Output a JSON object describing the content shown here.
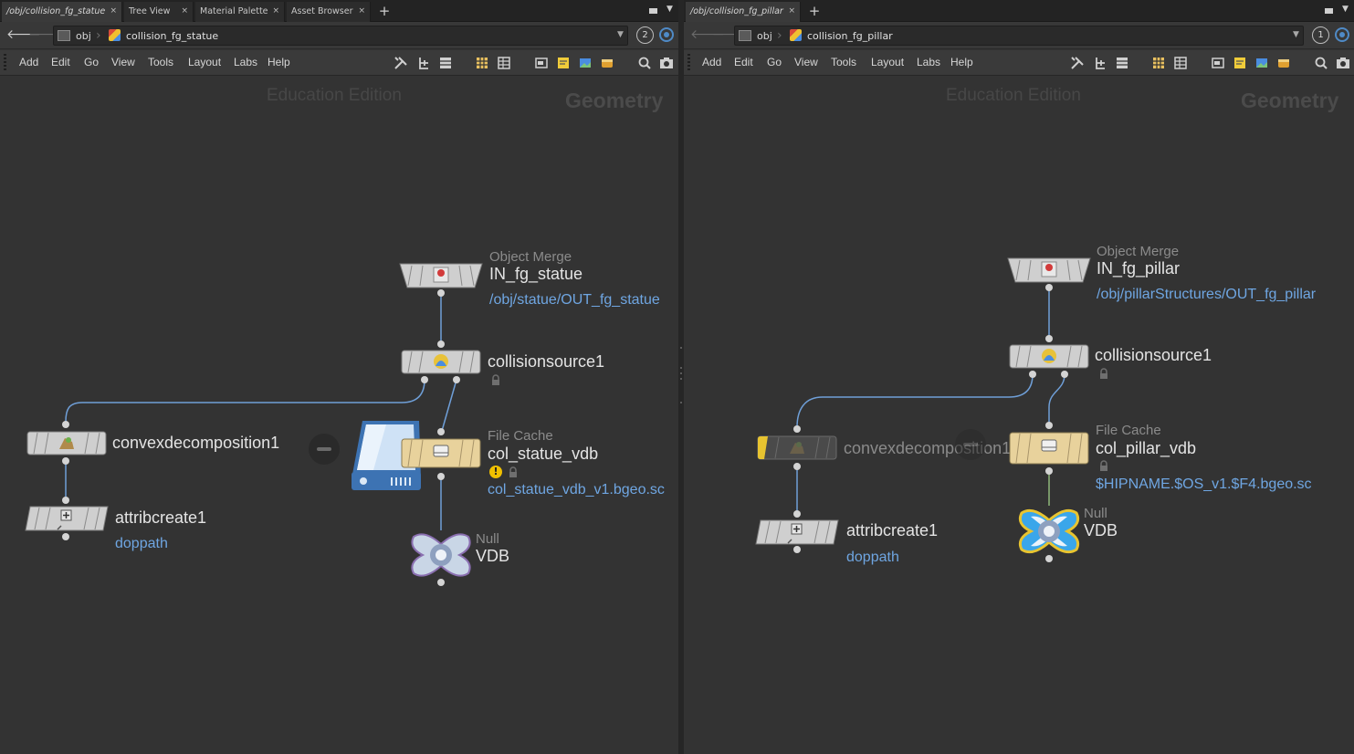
{
  "left": {
    "tabs": [
      {
        "label": "/obj/collision_fg_statue",
        "close": "×",
        "active": true
      },
      {
        "label": "Tree View",
        "close": "×"
      },
      {
        "label": "Material Palette",
        "close": "×"
      },
      {
        "label": "Asset Browser",
        "close": "×"
      }
    ],
    "add_tab": "+",
    "path": {
      "root": "obj",
      "network": "collision_fg_statue",
      "pin": "2"
    },
    "menu": [
      "Add",
      "Edit",
      "Go",
      "View",
      "Tools",
      "Layout",
      "Labs",
      "Help"
    ],
    "watermark": "Education Edition",
    "context": "Geometry",
    "nodes": {
      "object_merge": {
        "type": "Object Merge",
        "name": "IN_fg_statue",
        "path": "/obj/statue/OUT_fg_statue"
      },
      "collisionsource": {
        "name": "collisionsource1"
      },
      "convexdecomposition": {
        "name": "convexdecomposition1"
      },
      "attribcreate": {
        "name": "attribcreate1",
        "path": "doppath"
      },
      "file_cache": {
        "type": "File Cache",
        "name": "col_statue_vdb",
        "path": "col_statue_vdb_v1.bgeo.sc",
        "warning": "!"
      },
      "null": {
        "type": "Null",
        "name": "VDB"
      }
    }
  },
  "right": {
    "tabs": [
      {
        "label": "/obj/collision_fg_pillar",
        "close": "×",
        "active": true
      }
    ],
    "add_tab": "+",
    "path": {
      "root": "obj",
      "network": "collision_fg_pillar",
      "pin": "1"
    },
    "menu": [
      "Add",
      "Edit",
      "Go",
      "View",
      "Tools",
      "Layout",
      "Labs",
      "Help"
    ],
    "watermark": "Education Edition",
    "context": "Geometry",
    "nodes": {
      "object_merge": {
        "type": "Object Merge",
        "name": "IN_fg_pillar",
        "path": "/obj/pillarStructures/OUT_fg_pillar"
      },
      "collisionsource": {
        "name": "collisionsource1"
      },
      "convexdecomposition": {
        "name": "convexdecomposition1"
      },
      "attribcreate": {
        "name": "attribcreate1",
        "path": "doppath"
      },
      "file_cache": {
        "type": "File Cache",
        "name": "col_pillar_vdb",
        "path": "$HIPNAME.$OS_v1.$F4.bgeo.sc"
      },
      "null": {
        "type": "Null",
        "name": "VDB"
      }
    }
  },
  "colors": {
    "background": "#333333",
    "wire": "#6f9fd8",
    "param_link": "#6fa6e2",
    "file_cache_node": "#e8d29c",
    "bypass_flag": "#e8c430",
    "display_flag": "#4aa8e8",
    "template_flag": "#d99ad8"
  },
  "icons": [
    "back-arrow-icon",
    "forward-arrow-icon",
    "obj-network-icon",
    "geometry-network-icon",
    "wrench-icon",
    "tree-layout-icon",
    "list-icon",
    "grid-icon",
    "sticky-note-icon",
    "background-image-icon",
    "network-box-icon",
    "search-icon",
    "camera-icon",
    "lock-icon",
    "warning-icon",
    "drive-icon"
  ]
}
